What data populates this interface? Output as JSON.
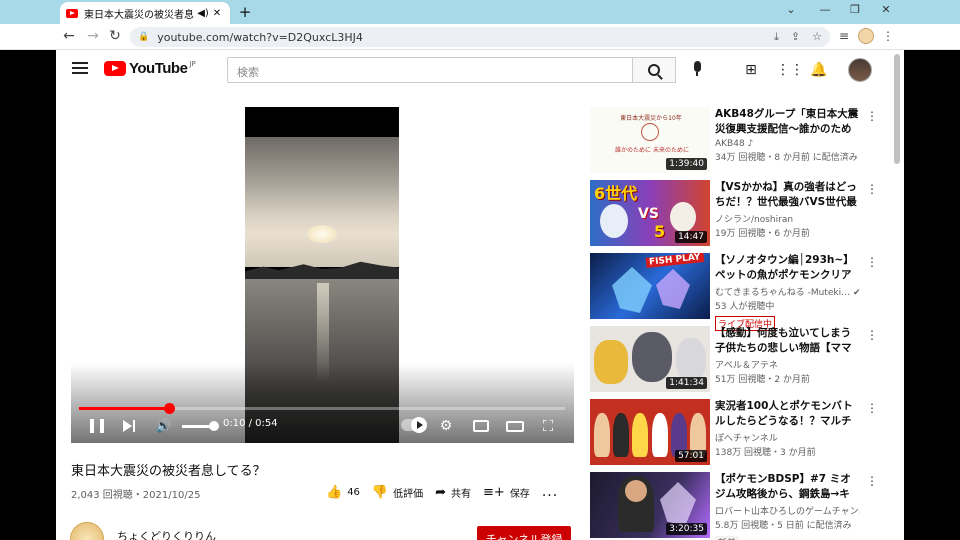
{
  "browser": {
    "tab_title": "東日本大震災の被災者息して",
    "new_tab": "+",
    "url": "youtube.com/watch?v=D2QuxcL3HJ4"
  },
  "header": {
    "logo_text": "YouTube",
    "logo_region": "JP",
    "search_placeholder": "検索"
  },
  "player": {
    "time": "0:10 / 0:54",
    "progress": 0.185,
    "volume": 0.95
  },
  "video": {
    "title": "東日本大震災の被災者息してる？",
    "meta": "2,043 回視聴・2021/10/25",
    "likes": "46",
    "dislike_label": "低評価",
    "share_label": "共有",
    "save_label": "保存",
    "more": "..."
  },
  "channel": {
    "name": "ちょくどりくりりん",
    "subscribe_label": "チャンネル登録"
  },
  "recommendations": [
    {
      "title": "AKB48グループ「東日本大震災復興支援配信～誰かのために…",
      "channel": "AKB48 ♪",
      "stats": "34万 回視聴・8 か月前 に配信済み",
      "duration": "1:39:40",
      "thumb_heading": "東日本大震災から10年",
      "thumb_caption": "誰かのために 未来のために"
    },
    {
      "title": "【VSかかね】真の強者はどっちだ！？世代最強バVS世代最強…",
      "channel": "ノシラン/noshiran",
      "stats": "19万 回視聴・6 か月前",
      "duration": "14:47",
      "thumb_big": "6世代",
      "thumb_vs": "VS",
      "thumb_num": "5"
    },
    {
      "title": "【ソノオタウン編│293h~】ペットの魚がポケモンクリア_Fi…",
      "channel": "むてきまるちゃんねる -Muteki… ✔",
      "stats": "53 人が視聴中",
      "badge": "ライブ配信中",
      "thumb_text": "FISH PLAY"
    },
    {
      "title": "【感動】何度も泣いてしまう子供たちの悲しい物語【ママに…",
      "channel": "アベル＆アテネ",
      "stats": "51万 回視聴・2 か月前",
      "duration": "1:41:34"
    },
    {
      "title": "実況者100人とポケモンバトルしたらどうなる！？マルチ実…",
      "channel": "ぽへチャンネル",
      "stats": "138万 回視聴・3 か月前",
      "duration": "57:01"
    },
    {
      "title": "【ポケモンBDSP】#7 ミオジム攻略後から、鋼鉄島→キッサ…",
      "channel": "ロバート山本ひろしのゲームチャン…",
      "stats": "5.8万 回視聴・5 日前 に配信済み",
      "duration": "3:20:35",
      "badge": "新着"
    }
  ],
  "colors": {
    "brand_red": "#ff0000",
    "subscribe_red": "#cc0000",
    "tabbar": "#a8d9e8"
  }
}
